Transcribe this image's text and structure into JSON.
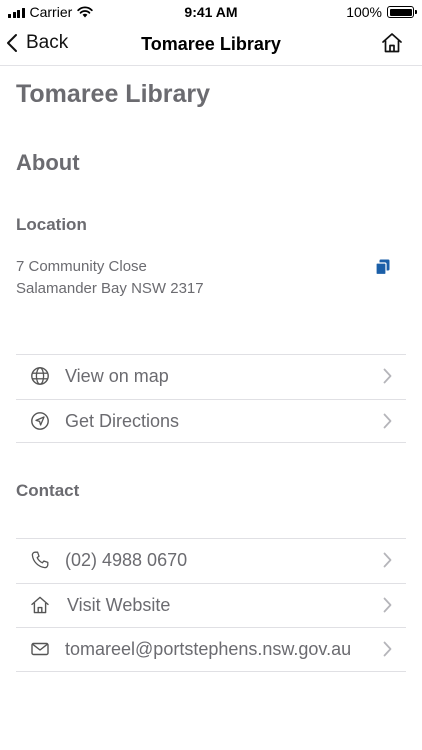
{
  "status_bar": {
    "carrier": "Carrier",
    "time": "9:41 AM",
    "battery": "100%",
    "signal_icon": "signal-bars-icon",
    "wifi_icon": "wifi-icon",
    "battery_icon": "battery-icon"
  },
  "nav": {
    "back_label": "Back",
    "title": "Tomaree Library",
    "back_icon": "chevron-left-icon",
    "home_icon": "home-icon"
  },
  "page": {
    "title": "Tomaree Library",
    "about_heading": "About",
    "location_heading": "Location",
    "address_line1": "7 Community Close",
    "address_line2": "Salamander Bay NSW 2317",
    "copy_icon": "copy-icon",
    "copy_icon_color": "#1b5fa8",
    "contact_heading": "Contact"
  },
  "location_actions": [
    {
      "label": "View on map",
      "icon": "globe-icon"
    },
    {
      "label": "Get Directions",
      "icon": "navigation-arrow-icon"
    }
  ],
  "contact_actions": [
    {
      "label": "(02) 4988 0670",
      "icon": "phone-icon"
    },
    {
      "label": "Visit Website",
      "icon": "home-icon"
    },
    {
      "label": "tomareel@portstephens.nsw.gov.au",
      "icon": "mail-icon"
    }
  ]
}
